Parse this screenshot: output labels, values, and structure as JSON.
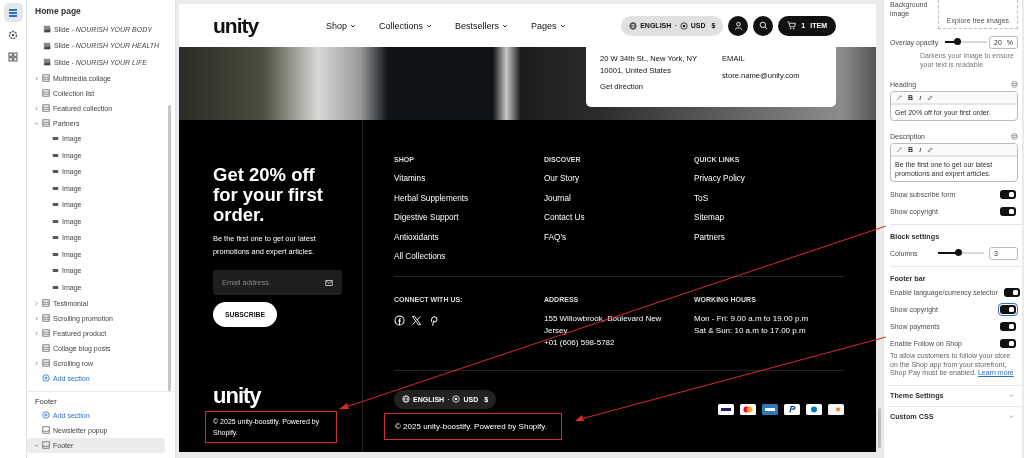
{
  "rail": [
    {
      "kind": "sections",
      "selected": true
    },
    {
      "kind": "settings",
      "selected": false
    },
    {
      "kind": "apps",
      "selected": false
    }
  ],
  "sidebar": {
    "title": "Home page",
    "items": [
      {
        "label": "Slide - *NOURISH YOUR BODY*",
        "kind": "block",
        "selected": false
      },
      {
        "label": "Slide - *NOURISH YOUR HEALTH*",
        "kind": "block",
        "selected": false
      },
      {
        "label": "Slide - *NOURISH YOUR LIFE*",
        "kind": "block",
        "selected": false
      },
      {
        "label": "Multimedia collage",
        "kind": "section",
        "expanded": false,
        "selected": false
      },
      {
        "label": "Collection list",
        "kind": "section",
        "selected": false
      },
      {
        "label": "Featured collection",
        "kind": "section",
        "expanded": false,
        "selected": false
      },
      {
        "label": "Partners",
        "kind": "section",
        "expanded": true,
        "selected": false,
        "children": [
          {
            "label": "Image",
            "kind": "logo",
            "selected": false
          },
          {
            "label": "Image",
            "kind": "logo",
            "selected": false
          },
          {
            "label": "Image",
            "kind": "logo",
            "selected": false
          },
          {
            "label": "Image",
            "kind": "logo",
            "selected": false
          },
          {
            "label": "Image",
            "kind": "logo",
            "selected": false
          },
          {
            "label": "Image",
            "kind": "logo",
            "selected": false
          },
          {
            "label": "Image",
            "kind": "logo",
            "selected": false
          },
          {
            "label": "Image",
            "kind": "logo",
            "selected": false
          },
          {
            "label": "Image",
            "kind": "logo",
            "selected": false
          },
          {
            "label": "Image",
            "kind": "logo",
            "selected": false
          }
        ]
      },
      {
        "label": "Testimonial",
        "kind": "section",
        "expanded": false,
        "selected": false
      },
      {
        "label": "Scrolling promotion",
        "kind": "section",
        "expanded": false,
        "selected": false
      },
      {
        "label": "Featured product",
        "kind": "section",
        "expanded": false,
        "selected": false
      },
      {
        "label": "Collage blog posts",
        "kind": "section",
        "selected": false
      },
      {
        "label": "Scrolling row",
        "kind": "section",
        "expanded": false,
        "selected": false
      },
      {
        "label": "Add section",
        "kind": "add"
      }
    ],
    "footer_title": "Footer",
    "footer_items": [
      {
        "label": "Add section",
        "kind": "add"
      },
      {
        "label": "Newsletter popup",
        "kind": "section",
        "selected": false
      },
      {
        "label": "Footer",
        "kind": "section",
        "expanded": true,
        "selected": true
      }
    ]
  },
  "nav": {
    "logo": "unity",
    "menu": [
      "Shop",
      "Collections",
      "Bestsellers",
      "Pages"
    ],
    "locale": {
      "language": "ENGLISH",
      "separator": "·",
      "currency": "USD",
      "symbol": "$"
    },
    "cart": {
      "count": "1",
      "label": "ITEM"
    }
  },
  "store_popup": {
    "address": "20 W 34th St., New York, NY 10001, United States",
    "link": "Get direction",
    "email_label": "EMAIL",
    "email": "store.name@unity.com"
  },
  "footer": {
    "promo": {
      "heading": "Get 20% off for your first order.",
      "text": "Be the first one to get our latest promotions and expert articles.",
      "email_placeholder": "Email address",
      "button": "SUBSCRIBE",
      "logo": "unity",
      "copyright": "© 2025 unity-boostify. Powered by Shopify."
    },
    "menus": [
      {
        "title": "SHOP",
        "links": [
          "Vitamins",
          "Herbal Supplements",
          "Digestive Support",
          "Antioxidants",
          "All Collections"
        ]
      },
      {
        "title": "DISCOVER",
        "links": [
          "Our Story",
          "Journal",
          "Contact Us",
          "FAQ’s"
        ]
      },
      {
        "title": "QUICK LINKS",
        "links": [
          "Privacy Policy",
          "ToS",
          "Sitemap",
          "Partners"
        ]
      }
    ],
    "connect": {
      "title": "CONNECT WITH US:",
      "socials": [
        {
          "kind": "facebook"
        },
        {
          "kind": "x"
        },
        {
          "kind": "pinterest"
        }
      ]
    },
    "address": {
      "title": "ADDRESS",
      "lines": [
        "155 Willowbrook, Boulevard New Jersey",
        "+01 (606) 598-5782"
      ]
    },
    "hours": {
      "title": "WORKING HOURS",
      "lines": [
        "Mon - Fri: 9.00 a.m to 19.00 p.m",
        "Sat & Sun: 10 a.m to 17.00 p.m"
      ]
    },
    "locale": {
      "language": "ENGLISH",
      "separator": "·",
      "currency": "USD",
      "symbol": "$"
    },
    "copyright": "© 2025 unity-boostify. Powered by Shopify.",
    "payments": [
      {
        "kind": "visa"
      },
      {
        "kind": "mastercard"
      },
      {
        "kind": "amex"
      },
      {
        "kind": "paypal"
      },
      {
        "kind": "diners"
      },
      {
        "kind": "discover"
      }
    ]
  },
  "settings": {
    "background_image": {
      "label": "Background image",
      "button": "Explore free images"
    },
    "overlay": {
      "label": "Overlay opacity",
      "level": 0.3,
      "value": "20",
      "unit": "%",
      "help": "Darkens your image to ensure your text is readable"
    },
    "editors": [
      {
        "label": "Heading",
        "toolbar": [
          "B",
          "I"
        ],
        "value": "Get 20% off for your first order."
      },
      {
        "label": "Description",
        "toolbar": [
          "B",
          "I"
        ],
        "value": "Be the first one to get our latest promotions and expert articles."
      }
    ],
    "toggles": [
      {
        "label": "Show subscribe form",
        "on": true,
        "focused": false
      },
      {
        "label": "Show copyright",
        "on": true,
        "focused": false
      }
    ],
    "block_settings": {
      "title": "Block settings",
      "label": "Columns",
      "level": 0.45,
      "value": "3"
    },
    "footer_bar": {
      "title": "Footer bar",
      "toggles": [
        {
          "label": "Enable language/currency selector",
          "on": true,
          "focused": false
        },
        {
          "label": "Show copyright",
          "on": true,
          "focused": true
        },
        {
          "label": "Show payments",
          "on": true,
          "focused": false
        },
        {
          "label": "Enable Follow on Shop",
          "on": true,
          "focused": false
        }
      ],
      "help": "To allow customers to follow your store on the Shop app from your storefront, Shop Pay must be enabled.",
      "link": "Learn more"
    },
    "collapsibles": [
      {
        "label": "Theme Settings",
        "expanded": false
      },
      {
        "label": "Custom CSS",
        "expanded": false
      }
    ]
  }
}
